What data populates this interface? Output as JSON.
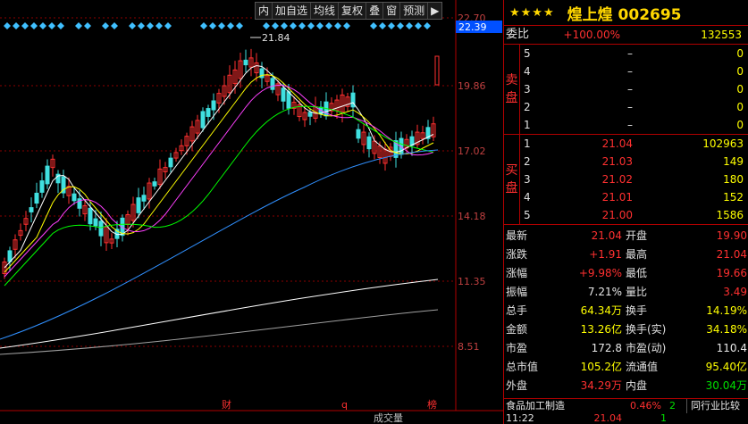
{
  "toolbar": [
    "内",
    "加自选",
    "均线",
    "复权",
    "叠",
    "窗",
    "预测",
    "▶"
  ],
  "axis": {
    "price_labels": [
      "22.70",
      "19.86",
      "17.02",
      "14.18",
      "11.35",
      "8.51"
    ],
    "current_price_tag": "22.39",
    "high_marker": "21.84",
    "bottom_markers": [
      "财",
      "q",
      "榜"
    ],
    "volume_label": "成交量"
  },
  "header": {
    "stars": "★★★★",
    "title": "煌上煌 002695"
  },
  "weibi": {
    "label": "委比",
    "pct": "+100.00%",
    "diff": "132553"
  },
  "sell": {
    "side_label": [
      "卖",
      "盘"
    ],
    "levels": [
      {
        "lvl": "5",
        "price": "–",
        "vol": "0"
      },
      {
        "lvl": "4",
        "price": "–",
        "vol": "0"
      },
      {
        "lvl": "3",
        "price": "–",
        "vol": "0"
      },
      {
        "lvl": "2",
        "price": "–",
        "vol": "0"
      },
      {
        "lvl": "1",
        "price": "–",
        "vol": "0"
      }
    ]
  },
  "buy": {
    "side_label": [
      "买",
      "盘"
    ],
    "levels": [
      {
        "lvl": "1",
        "price": "21.04",
        "vol": "102963"
      },
      {
        "lvl": "2",
        "price": "21.03",
        "vol": "149"
      },
      {
        "lvl": "3",
        "price": "21.02",
        "vol": "180"
      },
      {
        "lvl": "4",
        "price": "21.01",
        "vol": "152"
      },
      {
        "lvl": "5",
        "price": "21.00",
        "vol": "1586"
      }
    ]
  },
  "quote": [
    {
      "l1": "最新",
      "v1": "21.04",
      "c1": "red",
      "l2": "开盘",
      "v2": "19.90",
      "c2": "red"
    },
    {
      "l1": "涨跌",
      "v1": "+1.91",
      "c1": "red",
      "l2": "最高",
      "v2": "21.04",
      "c2": "red"
    },
    {
      "l1": "涨幅",
      "v1": "+9.98%",
      "c1": "red",
      "l2": "最低",
      "v2": "19.66",
      "c2": "red"
    },
    {
      "l1": "振幅",
      "v1": "7.21%",
      "c1": "white",
      "l2": "量比",
      "v2": "3.49",
      "c2": "red"
    },
    {
      "l1": "总手",
      "v1": "64.34万",
      "c1": "yellow",
      "l2": "换手",
      "v2": "14.19%",
      "c2": "yellow"
    },
    {
      "l1": "金额",
      "v1": "13.26亿",
      "c1": "yellow",
      "l2": "换手(实)",
      "v2": "34.18%",
      "c2": "yellow"
    },
    {
      "l1": "市盈",
      "v1": "172.8",
      "c1": "white",
      "l2": "市盈(动)",
      "v2": "110.4",
      "c2": "white"
    },
    {
      "l1": "总市值",
      "v1": "105.2亿",
      "c1": "yellow",
      "l2": "流通值",
      "v2": "95.40亿",
      "c2": "yellow"
    },
    {
      "l1": "外盘",
      "v1": "34.29万",
      "c1": "red",
      "l2": "内盘",
      "v2": "30.04万",
      "c2": "green"
    }
  ],
  "industry": {
    "name": "食品加工制造",
    "pct": "0.46%",
    "rank": "2",
    "compare": "同行业比较"
  },
  "bottom": {
    "time": "11:22",
    "price": "21.04",
    "extra": "1"
  },
  "colors": {
    "up": "#ff3030",
    "down": "#40e0e0",
    "border": "#b00000",
    "accent": "#ffd700"
  }
}
